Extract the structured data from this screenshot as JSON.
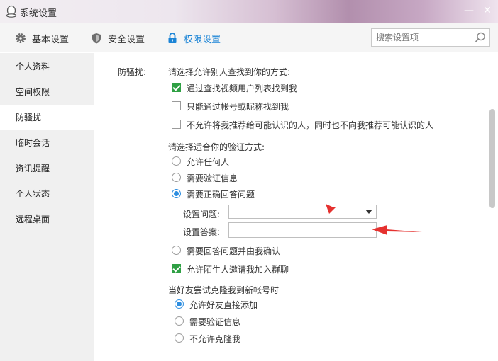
{
  "window": {
    "title": "系统设置",
    "minimize": "—",
    "close": "✕"
  },
  "tabs": [
    {
      "label": "基本设置",
      "icon": "gear-icon"
    },
    {
      "label": "安全设置",
      "icon": "shield-icon"
    },
    {
      "label": "权限设置",
      "icon": "lock-icon",
      "active": true
    }
  ],
  "search": {
    "placeholder": "搜索设置项"
  },
  "sidebar": {
    "items": [
      {
        "label": "个人资料"
      },
      {
        "label": "空间权限"
      },
      {
        "label": "防骚扰",
        "active": true
      },
      {
        "label": "临时会话"
      },
      {
        "label": "资讯提醒"
      },
      {
        "label": "个人状态"
      },
      {
        "label": "远程桌面"
      }
    ]
  },
  "main": {
    "section_label": "防骚扰:",
    "find_heading": "请选择允许别人查找到你的方式:",
    "find_options": [
      {
        "label": "通过查找视频用户列表找到我",
        "checked": true
      },
      {
        "label": "只能通过帐号或昵称找到我",
        "checked": false
      },
      {
        "label": "不允许将我推荐给可能认识的人，同时也不向我推荐可能认识的人",
        "checked": false
      }
    ],
    "verify_heading": "请选择适合你的验证方式:",
    "verify_options": [
      {
        "label": "允许任何人",
        "checked": false
      },
      {
        "label": "需要验证信息",
        "checked": false
      },
      {
        "label": "需要正确回答问题",
        "checked": true
      }
    ],
    "question_label": "设置问题:",
    "question_value": "",
    "answer_label": "设置答案:",
    "answer_value": "",
    "confirm_option": {
      "label": "需要回答问题并由我确认",
      "checked": false
    },
    "group_invite": {
      "label": "允许陌生人邀请我加入群聊",
      "checked": true
    },
    "clone_heading": "当好友尝试克隆我到新帐号时",
    "clone_options": [
      {
        "label": "允许好友直接添加",
        "checked": true
      },
      {
        "label": "需要验证信息",
        "checked": false
      },
      {
        "label": "不允许克隆我",
        "checked": false
      }
    ]
  },
  "colors": {
    "accent": "#1b84d6",
    "check_green": "#2fa044",
    "annotation_red": "#e5312f"
  }
}
